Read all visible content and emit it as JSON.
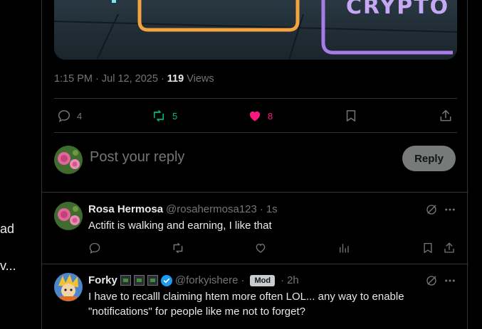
{
  "left_sidebar": {
    "fragment_1": "ad",
    "fragment_2": "v..."
  },
  "tweet": {
    "media": {
      "overlay_text": "CRYPTO"
    },
    "time": "1:15 PM",
    "date": "Jul 12, 2025",
    "views_count": "119",
    "views_label": "Views",
    "stats": {
      "replies": "4",
      "reposts": "5",
      "likes": "8"
    }
  },
  "composer": {
    "placeholder": "Post your reply",
    "reply_button": "Reply"
  },
  "replies": [
    {
      "name": "Rosa Hermosa",
      "handle": "@rosahermosa123",
      "time": "1s",
      "text": "Actifit is walking and earning, I like that"
    },
    {
      "name": "Forky",
      "handle": "@forkyishere",
      "badge": "Mod",
      "time": "2h",
      "text": "I have to recalll claiming htem more often LOL... any way to enable \"notifications\" for people like me not to forget?"
    }
  ],
  "colors": {
    "repost_active": "#00ba7c",
    "like_active": "#f91880",
    "verified": "#1d9bf0",
    "muted": "#71767b"
  }
}
